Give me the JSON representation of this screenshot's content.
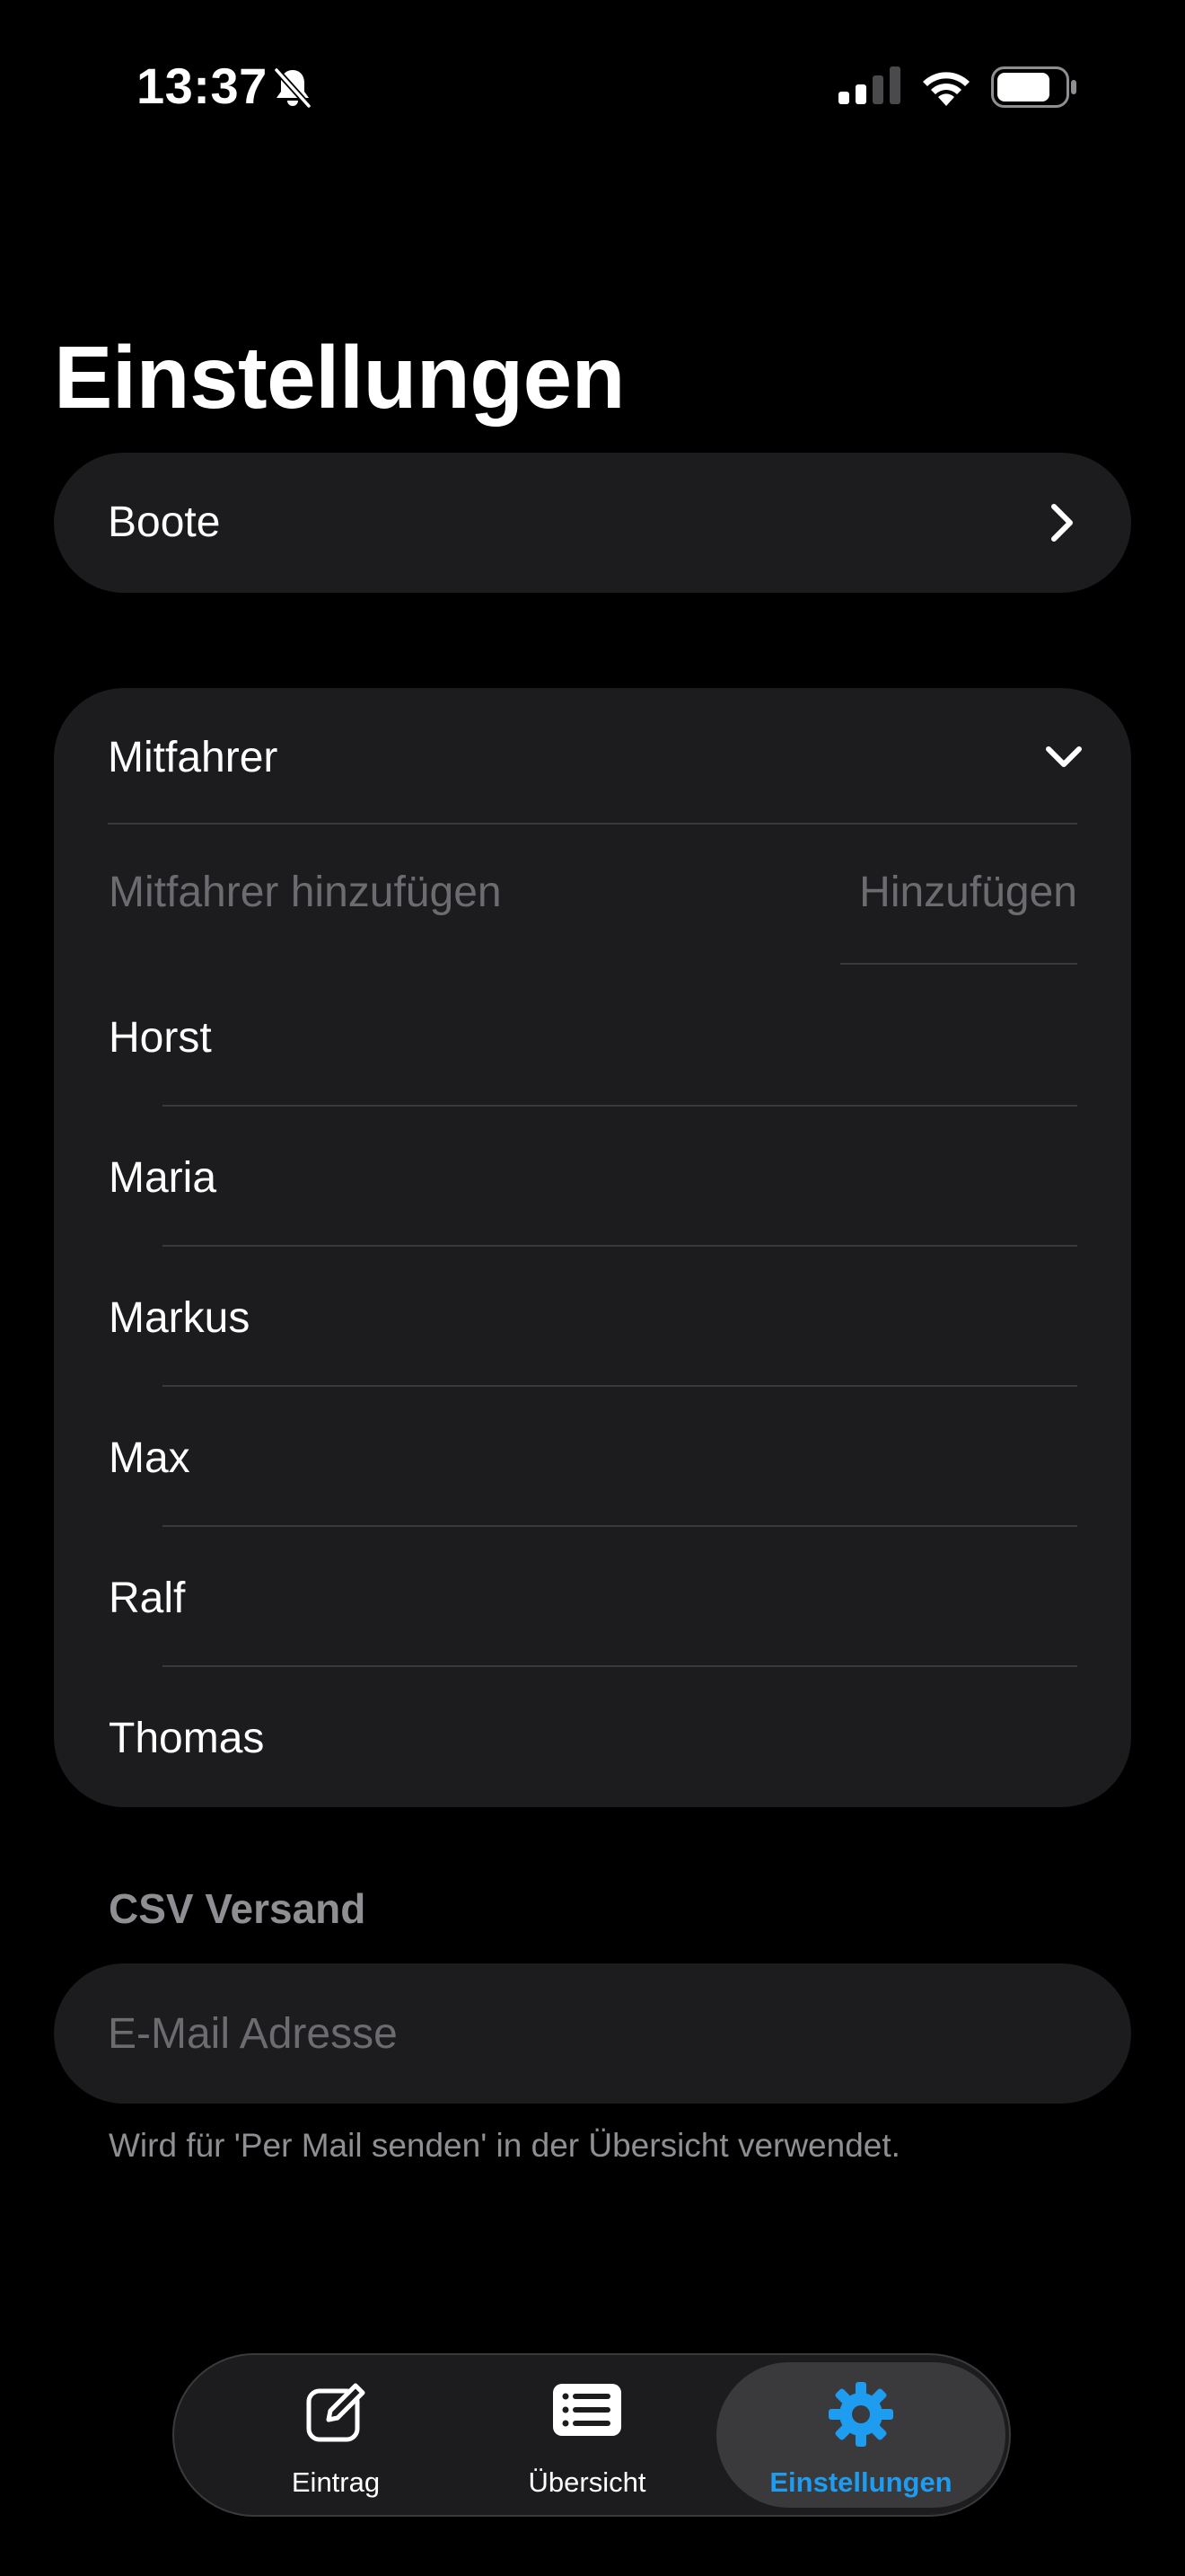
{
  "status_bar": {
    "time": "13:37",
    "icons": [
      "bell-slash-icon",
      "cellular-signal-icon",
      "wifi-icon",
      "battery-icon"
    ]
  },
  "page": {
    "title": "Einstellungen"
  },
  "boote": {
    "label": "Boote",
    "icon": "chevron-right-icon"
  },
  "mitfahrer": {
    "label": "Mitfahrer",
    "icon": "chevron-down-icon",
    "add_placeholder": "Mitfahrer hinzufügen",
    "add_button": "Hinzufügen",
    "people": [
      "Horst",
      "Maria",
      "Markus",
      "Max",
      "Ralf",
      "Thomas"
    ]
  },
  "csv": {
    "header": "CSV Versand",
    "email_placeholder": "E-Mail Adresse",
    "email_value": "",
    "footnote": "Wird für 'Per Mail senden' in der Übersicht verwendet."
  },
  "tabs": [
    {
      "label": "Eintrag",
      "icon": "compose-icon",
      "active": false
    },
    {
      "label": "Übersicht",
      "icon": "list-icon",
      "active": false
    },
    {
      "label": "Einstellungen",
      "icon": "gear-icon",
      "active": true
    }
  ],
  "colors": {
    "background": "#000000",
    "card": "#1c1c1e",
    "accent": "#1e9cf0",
    "secondary_text": "#8e8e93",
    "placeholder": "#6b6b70"
  }
}
